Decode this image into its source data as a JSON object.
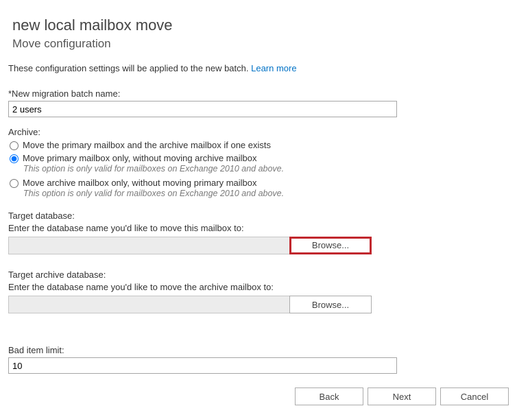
{
  "header": {
    "title": "new local mailbox move",
    "subtitle": "Move configuration"
  },
  "intro": {
    "text": "These configuration settings will be applied to the new batch. ",
    "link": "Learn more"
  },
  "batch_name": {
    "label": "*New migration batch name:",
    "value": "2 users"
  },
  "archive": {
    "label": "Archive:",
    "options": {
      "opt1_label": "Move the primary mailbox and the archive mailbox if one exists",
      "opt2_label": "Move primary mailbox only, without moving archive mailbox",
      "opt2_hint": "This option is only valid for mailboxes on Exchange 2010 and above.",
      "opt3_label": "Move archive mailbox only, without moving primary mailbox",
      "opt3_hint": "This option is only valid for mailboxes on Exchange 2010 and above."
    },
    "selected": "opt2"
  },
  "target_db": {
    "title": "Target database:",
    "desc": "Enter the database name you'd like to move this mailbox to:",
    "value": "",
    "browse": "Browse..."
  },
  "target_archive_db": {
    "title": "Target archive database:",
    "desc": "Enter the database name you'd like to move the archive mailbox to:",
    "value": "",
    "browse": "Browse..."
  },
  "bad_item": {
    "label": "Bad item limit:",
    "value": "10"
  },
  "footer": {
    "back": "Back",
    "next": "Next",
    "cancel": "Cancel"
  }
}
